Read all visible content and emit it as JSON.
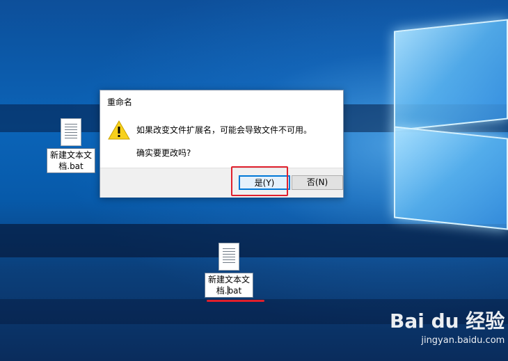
{
  "desktop": {
    "icons": [
      {
        "label": "新建文本文档.bat"
      },
      {
        "label_line1": "新建文本文",
        "label_line2_before": "档.",
        "label_line2_after": "bat"
      }
    ]
  },
  "dialog": {
    "title": "重命名",
    "message": "如果改变文件扩展名，可能会导致文件不可用。",
    "question": "确实要更改吗?",
    "yes_label": "是(Y)",
    "no_label": "否(N)",
    "icon": "warning-icon"
  },
  "watermark": {
    "logo_text": "Bai du 经验",
    "url": "jingyan.baidu.com"
  },
  "annotation": {
    "color": "#e0202c"
  }
}
